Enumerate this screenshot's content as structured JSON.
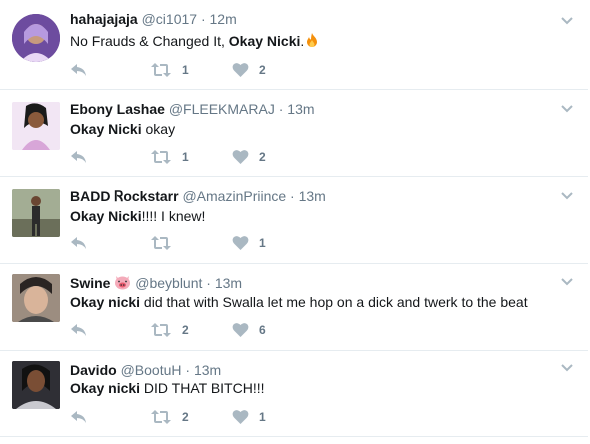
{
  "tweets": [
    {
      "name": "hahajajaja",
      "handle": "@ci1017",
      "time": "12m",
      "text_before": "No Frauds & Changed It, ",
      "text_bold": "Okay Nicki",
      "text_after": ".",
      "emoji": "fire-emoji",
      "retweets": "1",
      "likes": "2"
    },
    {
      "name": "Ebony Lashae",
      "handle": "@FLEEKMARAJ",
      "time": "13m",
      "text_bold": "Okay Nicki",
      "text_after": " okay",
      "retweets": "1",
      "likes": "2"
    },
    {
      "name": "BADD Ꮢockstarr",
      "handle": "@AmazinPriince",
      "time": "13m",
      "text_bold": "Okay Nicki",
      "text_after": "!!!! I knew!",
      "retweets": "",
      "likes": "1"
    },
    {
      "name": "Swine",
      "name_emoji": "pig-face-emoji",
      "handle": "@beyblunt",
      "time": "13m",
      "text_bold": "Okay nicki",
      "text_after": " did that with Swalla let me hop on a dick and twerk to the beat",
      "retweets": "2",
      "likes": "6"
    },
    {
      "name": "Davido",
      "handle": "@BootuH",
      "time": "13m",
      "text_bold": "Okay nicki",
      "text_after": " DID THAT BITCH!!!",
      "retweets": "2",
      "likes": "1"
    }
  ],
  "separator": "·",
  "colors": {
    "icon": "#aab8c2",
    "muted": "#657786",
    "border": "#e6ecf0"
  }
}
